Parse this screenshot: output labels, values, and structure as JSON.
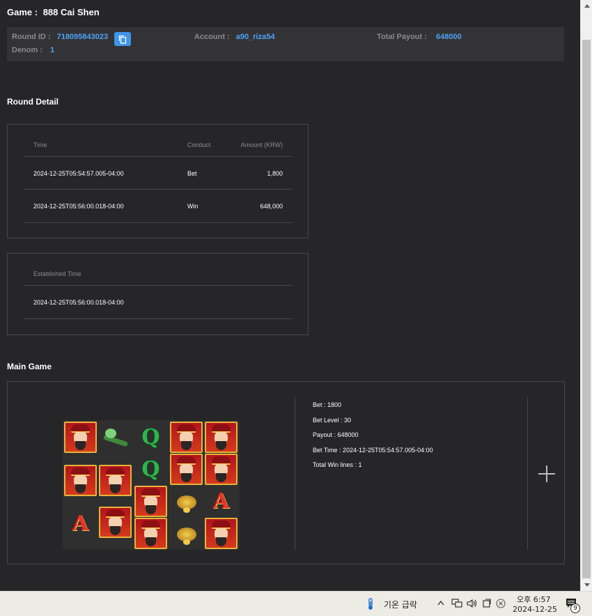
{
  "game": {
    "label": "Game :",
    "name": "888 Cai Shen"
  },
  "info": {
    "round_id_label": "Round ID :",
    "round_id": "718095843023",
    "account_label": "Account :",
    "account": "a90_riza54",
    "payout_label": "Total Payout :",
    "payout": "648000",
    "denom_label": "Denom :",
    "denom": "1"
  },
  "round_detail": {
    "title": "Round Detail",
    "headers": [
      "Time",
      "Conduct",
      "Amount (KRW)"
    ],
    "rows": [
      {
        "time": "2024-12-25T05:54:57.005-04:00",
        "conduct": "Bet",
        "amount": "1,800"
      },
      {
        "time": "2024-12-25T05:56:00.018-04:00",
        "conduct": "Win",
        "amount": "648,000"
      }
    ]
  },
  "established": {
    "header": "Established Time",
    "value": "2024-12-25T05:56:00.018-04:00"
  },
  "main_game": {
    "title": "Main Game",
    "lines": [
      "Bet : 1800",
      "Bet Level : 30",
      "Payout : 648000",
      "Bet Time : 2024-12-25T05:54:57.005-04:00",
      "Total Win lines : 1"
    ],
    "reels": [
      [
        "cai-shen",
        "cai-shen",
        "letter-a"
      ],
      [
        "ruyi",
        "cai-shen",
        "cai-shen"
      ],
      [
        "q",
        "q",
        "cai-shen",
        "cai-shen"
      ],
      [
        "cai-shen",
        "cai-shen",
        "golden-toad",
        "golden-toad"
      ],
      [
        "cai-shen",
        "cai-shen",
        "letter-a",
        "cai-shen"
      ]
    ],
    "letter_q": "Q",
    "letter_a": "A"
  },
  "taskbar": {
    "weather": "기온 급락",
    "time": "오후 6:57",
    "date": "2024-12-25",
    "notification_count": "9"
  }
}
